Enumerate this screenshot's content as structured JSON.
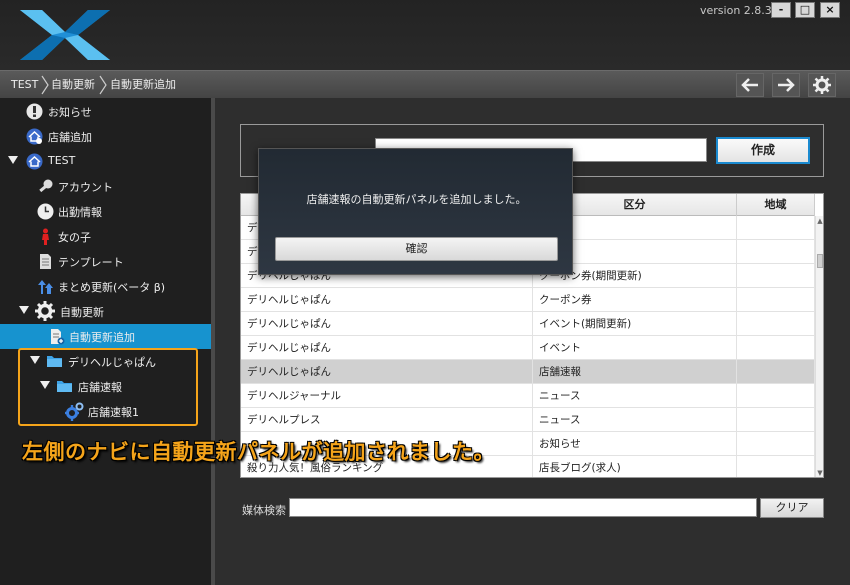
{
  "window": {
    "version": "version 2.8.3",
    "controls": {
      "minimize": "-",
      "maximize": "□",
      "close": "×"
    }
  },
  "breadcrumb": [
    "TEST",
    "自動更新",
    "自動更新追加"
  ],
  "toolbar": {
    "back_icon": "left-arrow-icon",
    "forward_icon": "right-arrow-icon",
    "settings_icon": "gear-icon"
  },
  "sidebar": {
    "items": [
      {
        "label": "お知らせ",
        "icon": "info-icon"
      },
      {
        "label": "店舗追加",
        "icon": "home-add-icon"
      },
      {
        "label": "TEST",
        "icon": "home-icon"
      },
      {
        "label": "アカウント",
        "icon": "key-icon"
      },
      {
        "label": "出勤情報",
        "icon": "clock-icon"
      },
      {
        "label": "女の子",
        "icon": "person-icon"
      },
      {
        "label": "テンプレート",
        "icon": "document-icon"
      },
      {
        "label": "まとめ更新(ベータ β)",
        "icon": "upload-icon"
      },
      {
        "label": "自動更新",
        "icon": "gear-icon"
      },
      {
        "label": "自動更新追加",
        "icon": "add-document-icon"
      },
      {
        "label": "デリヘルじゃぱん",
        "icon": "folder-icon"
      },
      {
        "label": "店舗速報",
        "icon": "folder-icon"
      },
      {
        "label": "店舗速報1",
        "icon": "gears-icon"
      }
    ],
    "selected": "自動更新追加"
  },
  "form": {
    "create_label": "作成"
  },
  "table": {
    "columns": [
      "",
      "区分",
      "地域"
    ],
    "rows": [
      [
        "デリ",
        "",
        ""
      ],
      [
        "デリ",
        "",
        ""
      ],
      [
        "デリヘルじゃぱん",
        "クーポン券(期間更新)",
        ""
      ],
      [
        "デリヘルじゃぱん",
        "クーポン券",
        ""
      ],
      [
        "デリヘルじゃぱん",
        "イベント(期間更新)",
        ""
      ],
      [
        "デリヘルじゃぱん",
        "イベント",
        ""
      ],
      [
        "デリヘルじゃぱん",
        "店舗速報",
        ""
      ],
      [
        "デリヘルジャーナル",
        "ニュース",
        ""
      ],
      [
        "デリヘルプレス",
        "ニュース",
        ""
      ],
      [
        "",
        "お知らせ",
        ""
      ],
      [
        "殺り力人気！風俗ランキング",
        "店長ブログ(求人)",
        ""
      ]
    ],
    "selected_row": 6
  },
  "search": {
    "label": "媒体検索",
    "value": "",
    "clear_label": "クリア"
  },
  "modal": {
    "message": "店舗速報の自動更新パネルを追加しました。",
    "ok_label": "確認"
  },
  "annotation": {
    "text": "左側のナビに自動更新パネルが追加されました。",
    "color": "#f5a41a"
  },
  "colors": {
    "accent": "#1793cf",
    "annotation": "#f5a41a"
  }
}
